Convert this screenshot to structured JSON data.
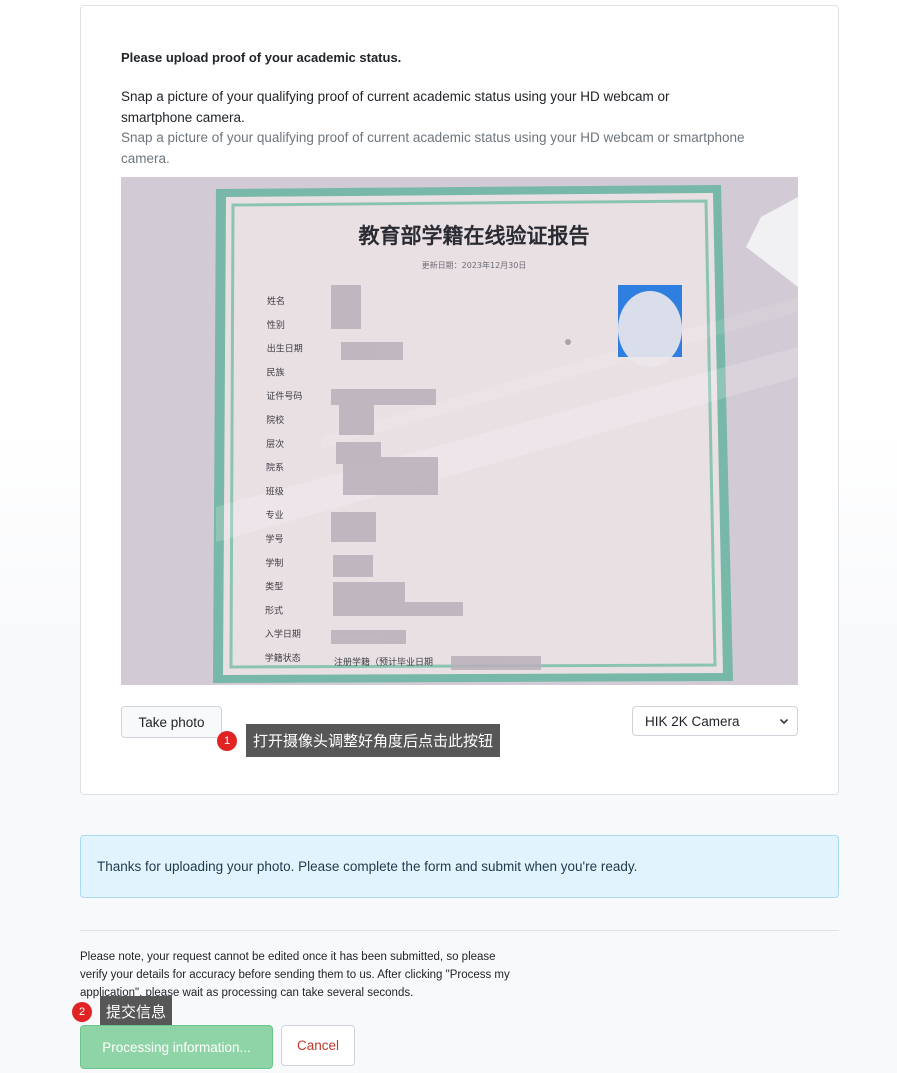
{
  "upload_card": {
    "heading": "Please upload proof of your academic status.",
    "description": "Snap a picture of your qualifying proof of current academic status using your HD webcam or smartphone camera.",
    "hint": "Snap a picture of your qualifying proof of current academic status using your HD webcam or smartphone camera.",
    "document": {
      "title": "教育部学籍在线验证报告",
      "updated": "更新日期：2023年12月30日",
      "fields": [
        "姓名",
        "性别",
        "出生日期",
        "民族",
        "证件号码",
        "院校",
        "层次",
        "院系",
        "班级",
        "专业",
        "学号",
        "学制",
        "类型",
        "形式",
        "入学日期",
        "学籍状态"
      ],
      "status_value": "注册学籍（预计毕业日期"
    },
    "take_photo_label": "Take photo",
    "camera_selected": "HIK 2K Camera"
  },
  "callouts": [
    {
      "number": "1",
      "text": "打开摄像头调整好角度后点击此按钮"
    },
    {
      "number": "2",
      "text": "提交信息"
    }
  ],
  "alert": {
    "message": "Thanks for uploading your photo. Please complete the form and submit when you're ready."
  },
  "footer": {
    "note": "Please note, your request cannot be edited once it has been submitted, so please verify your details for accuracy before sending them to us. After clicking \"Process my application\", please wait as processing can take several seconds.",
    "process_label": "Processing information...",
    "cancel_label": "Cancel"
  },
  "colors": {
    "callout_badge": "#e02424",
    "callout_box": "#575757",
    "alert_bg": "#e1f3fd",
    "process_button": "#8fd4a6",
    "cancel_text": "#c0392b"
  }
}
